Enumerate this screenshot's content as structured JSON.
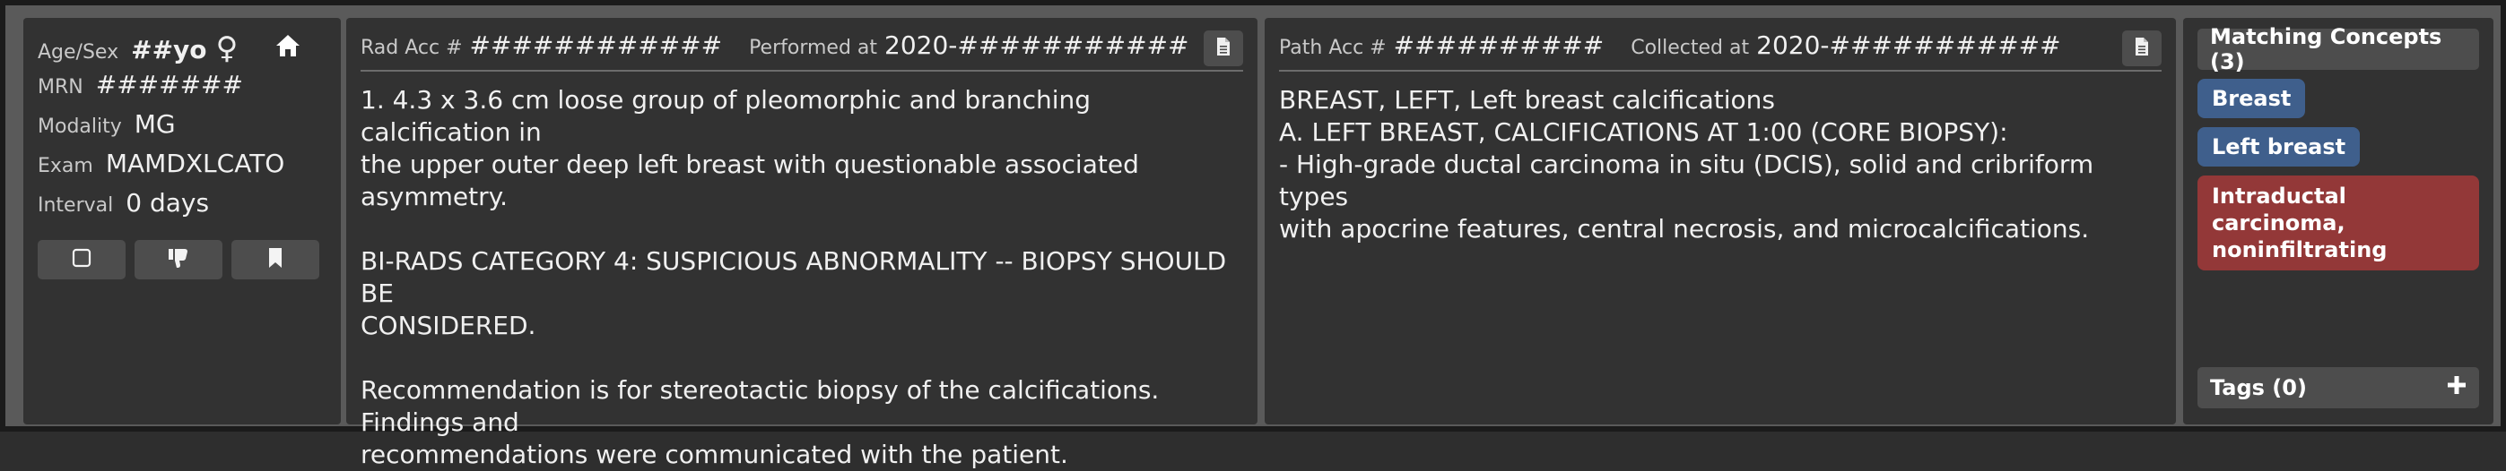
{
  "patient": {
    "age_sex_label": "Age/Sex",
    "age_sex_value": "##yo",
    "sex_symbol": "♀",
    "home_icon": "home-icon",
    "mrn_label": "MRN",
    "mrn_value": "#######",
    "modality_label": "Modality",
    "modality_value": "MG",
    "exam_label": "Exam",
    "exam_value": "MAMDXLCATO",
    "interval_label": "Interval",
    "interval_value": "0 days",
    "buttons": [
      "square-icon",
      "thumbs-down-icon",
      "bookmark-icon"
    ]
  },
  "rad": {
    "acc_label": "Rad Acc #",
    "acc_value": "############",
    "performed_label": "Performed at",
    "performed_value": "2020-###########",
    "report_lines": [
      "1. 4.3 x 3.6 cm loose group of pleomorphic and branching calcification in",
      "the upper outer deep left breast with questionable associated asymmetry.",
      "BI-RADS CATEGORY 4: SUSPICIOUS ABNORMALITY -- BIOPSY SHOULD BE",
      "CONSIDERED.",
      "Recommendation is for stereotactic biopsy of the calcifications. Findings and",
      "recommendations were communicated with the patient."
    ]
  },
  "path": {
    "acc_label": "Path Acc #",
    "acc_value": "##########",
    "collected_label": "Collected at",
    "collected_value": "2020-###########",
    "report_lines": [
      "BREAST, LEFT, Left breast calcifications",
      "A. LEFT BREAST, CALCIFICATIONS AT 1:00 (CORE BIOPSY):",
      "- High-grade ductal carcinoma in situ (DCIS), solid and cribriform types",
      "with apocrine features, central necrosis, and microcalcifications."
    ]
  },
  "concepts": {
    "title": "Matching Concepts (3)",
    "chips": [
      "Breast",
      "Left breast"
    ],
    "red_chip": "Intraductal carcinoma, noninfiltrating",
    "tags_label": "Tags (0)",
    "colors": {
      "blue_chip": "#3f5f8c",
      "red_chip": "#933838"
    }
  }
}
